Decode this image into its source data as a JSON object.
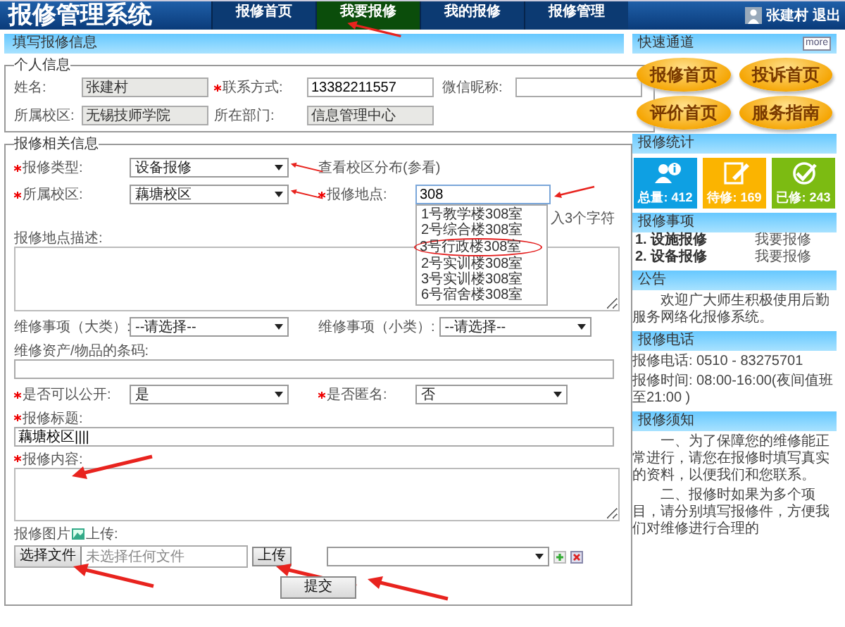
{
  "header": {
    "title": "报修管理系统",
    "nav": [
      {
        "label": "报修首页",
        "selected": false,
        "arrow": false
      },
      {
        "label": "我要报修",
        "selected": true,
        "arrow": true
      },
      {
        "label": "我的报修",
        "selected": false,
        "arrow": false
      },
      {
        "label": "报修管理",
        "selected": false,
        "arrow": false
      }
    ],
    "user": "张建村",
    "logout": "退出"
  },
  "form": {
    "banner": "填写报修信息",
    "personal": {
      "legend": "个人信息",
      "fields": [
        {
          "label": "姓名:",
          "value": "张建村",
          "required": false,
          "readonly": true
        },
        {
          "label": "联系方式:",
          "value": "13382211557",
          "required": true,
          "readonly": false
        },
        {
          "label": "微信昵称:",
          "required": false,
          "readonly": false
        },
        {
          "label": "所属校区:",
          "value": "无锡技师学院",
          "required": false,
          "readonly": true
        },
        {
          "label": "所在部门:",
          "value": "信息管理中心",
          "required": false,
          "readonly": true
        }
      ]
    },
    "repair": {
      "legend": "报修相关信息",
      "type": {
        "label": "报修类型:",
        "value": "设备报修",
        "required": true,
        "arrow": true
      },
      "map_link": "查看校区分布(参看)",
      "campus": {
        "label": "所属校区:",
        "value": "藕塘校区",
        "required": true,
        "arrow": true
      },
      "location": {
        "label": "报修地点:",
        "value": "308",
        "required": true,
        "arrow": true,
        "hint": "入3个字符",
        "suggestions": [
          {
            "label": "1号教学楼308室",
            "circled": false
          },
          {
            "label": "2号综合楼308室",
            "circled": false
          },
          {
            "label": "3号行政楼308室",
            "circled": true
          },
          {
            "label": "2号实训楼308室",
            "circled": false
          },
          {
            "label": "3号实训楼308室",
            "circled": false
          },
          {
            "label": "6号宿舍楼308室",
            "circled": false
          }
        ]
      },
      "location_desc": {
        "label": "报修地点描述:"
      },
      "category_major": {
        "label": "维修事项（大类）:",
        "value": "--请选择--",
        "required": false
      },
      "category_minor": {
        "label": "维修事项（小类）:",
        "value": "--请选择--",
        "required": false
      },
      "barcode": {
        "label": "维修资产/物品的条码:"
      },
      "public": {
        "label": "是否可以公开:",
        "value": "是",
        "required": true
      },
      "anonymous": {
        "label": "是否匿名:",
        "value": "否",
        "required": true
      },
      "title": {
        "label": "报修标题:",
        "value": "藕塘校区||||",
        "required": true
      },
      "content": {
        "label": "报修内容:",
        "required": true,
        "arrow": true
      },
      "photo": {
        "label": "报修图片",
        "label_after": "上传:",
        "choose": "选择文件",
        "no_file": "未选择任何文件",
        "upload": "上传",
        "choose_arrow": true,
        "upload_arrow": true
      },
      "submit": {
        "label": "提交",
        "arrow": true
      }
    }
  },
  "sidebar": {
    "quick": {
      "title": "快速通道",
      "more": "more",
      "links": [
        "报修首页",
        "投诉首页",
        "评价首页",
        "服务指南"
      ]
    },
    "stats": {
      "title": "报修统计",
      "tiles": [
        {
          "label": "总量: 412",
          "color": "#0ea0e3",
          "kind": "users"
        },
        {
          "label": "待修: 169",
          "color": "#fbb400",
          "kind": "edit"
        },
        {
          "label": "已修: 243",
          "color": "#7cbb12",
          "kind": "check"
        }
      ]
    },
    "items": {
      "title": "报修事项",
      "rows": [
        {
          "name": "1. 设施报修",
          "action": "我要报修"
        },
        {
          "name": "2. 设备报修",
          "action": "我要报修"
        }
      ]
    },
    "notice": {
      "title": "公告",
      "text": "欢迎广大师生积极使用后勤服务网络化报修系统。"
    },
    "phone": {
      "title": "报修电话",
      "lines": [
        "报修电话: 0510 - 83275701",
        "报修时间: 08:00-16:00(夜间值班至21:00 )"
      ]
    },
    "rules": {
      "title": "报修须知",
      "paragraphs": [
        "一、为了保障您的维修能正常进行，请您在报修时填写真实的资料，以便我们和您联系。",
        "二、报修时如果为多个项目，请分别填写报修件，方便我们对维修进行合理的"
      ]
    }
  }
}
